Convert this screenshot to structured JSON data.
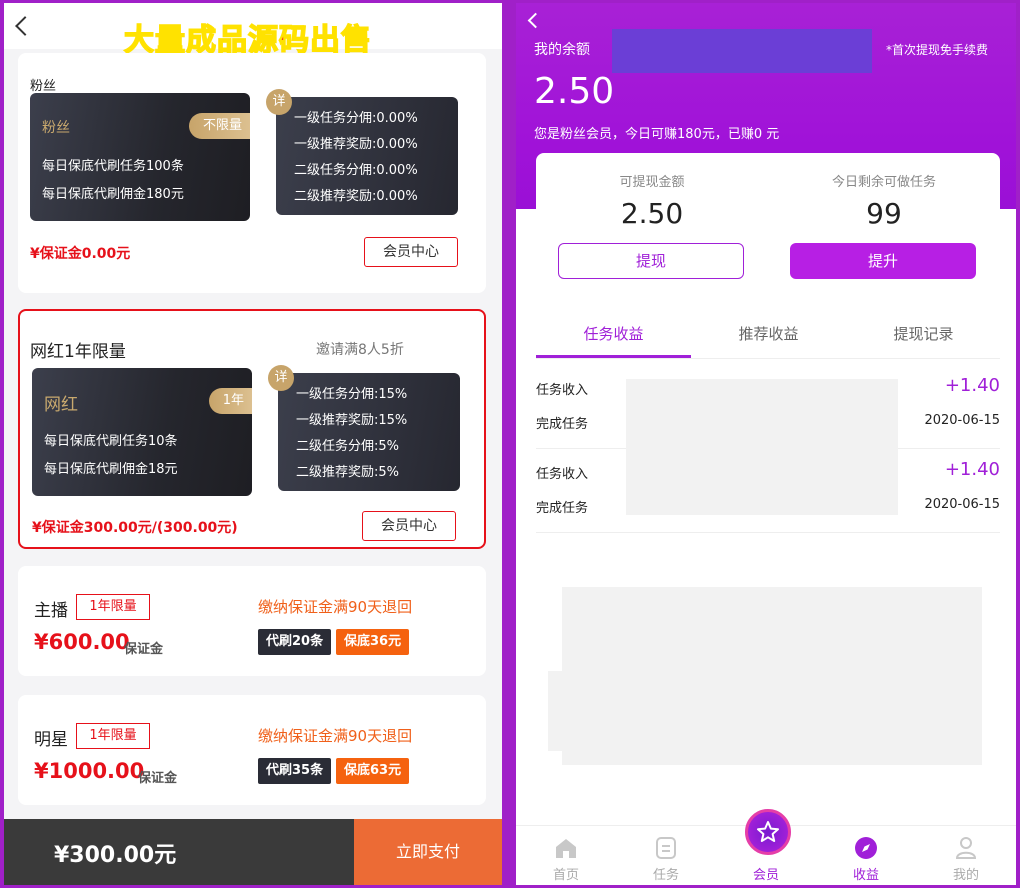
{
  "watermark": "大量成品源码出售",
  "left": {
    "card1": {
      "section_title": "粉丝",
      "level_name": "粉丝",
      "tag": "不限量",
      "daily_tasks": "每日保底代刷任务100条",
      "daily_commission": "每日保底代刷佣金180元",
      "detail_badge": "详",
      "details": [
        "一级任务分佣:0.00%",
        "一级推荐奖励:0.00%",
        "二级任务分佣:0.00%",
        "二级推荐奖励:0.00%"
      ],
      "deposit": "¥保证金0.00元",
      "button": "会员中心"
    },
    "card2": {
      "title": "网红1年限量",
      "invite_note": "邀请满8人5折",
      "level_name": "网红",
      "tag": "1年",
      "daily_tasks": "每日保底代刷任务10条",
      "daily_commission": "每日保底代刷佣金18元",
      "detail_badge": "详",
      "details": [
        "一级任务分佣:15%",
        "一级推荐奖励:15%",
        "二级任务分佣:5%",
        "二级推荐奖励:5%"
      ],
      "deposit": "¥保证金300.00元/(300.00元)",
      "button": "会员中心"
    },
    "card3": {
      "name": "主播",
      "badge": "1年限量",
      "price": "¥600.00",
      "price_unit": "保证金",
      "refund_note": "缴纳保证金满90天退回",
      "chip_tasks": "代刷20条",
      "chip_deposit": "保底36元"
    },
    "card4": {
      "name": "明星",
      "badge": "1年限量",
      "price": "¥1000.00",
      "price_unit": "保证金",
      "refund_note": "缴纳保证金满90天退回",
      "chip_tasks": "代刷35条",
      "chip_deposit": "保底63元"
    },
    "paybar": {
      "total": "¥300.00元",
      "pay_button": "立即支付"
    }
  },
  "right": {
    "balance_label": "我的余额",
    "first_withdraw_note": "*首次提现免手续费",
    "balance": "2.50",
    "member_note": "您是粉丝会员，今日可赚180元，已赚0 元",
    "stats": {
      "withdrawable_label": "可提现金额",
      "withdrawable_value": "2.50",
      "remaining_label": "今日剩余可做任务",
      "remaining_value": "99"
    },
    "withdraw_button": "提现",
    "upgrade_button": "提升",
    "tabs": [
      "任务收益",
      "推荐收益",
      "提现记录"
    ],
    "records": [
      {
        "type": "任务收入",
        "desc": "完成任务",
        "amount": "+1.40",
        "date": "2020-06-15"
      },
      {
        "type": "任务收入",
        "desc": "完成任务",
        "amount": "+1.40",
        "date": "2020-06-15"
      }
    ],
    "nav": [
      "首页",
      "任务",
      "会员",
      "收益",
      "我的"
    ]
  },
  "colors": {
    "brand_purple": "#a020d8",
    "alert_red": "#e6111a",
    "accent_orange": "#f5620f",
    "gold": "#c7a46a"
  }
}
